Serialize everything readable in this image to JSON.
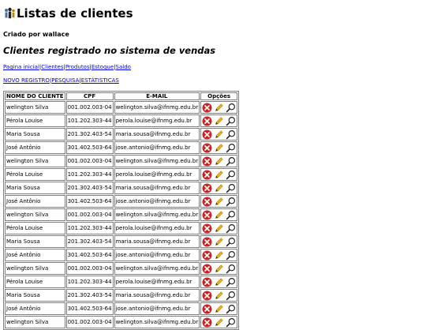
{
  "header": {
    "title": "Listas de clientes",
    "created_by": "Criado por wallace",
    "subtitle": "Clientes registrado no sistema de vendas"
  },
  "nav": {
    "links": [
      "Pagina inicial",
      "Clientes",
      "Produtos",
      "Estoque",
      "Saldo"
    ]
  },
  "actions": {
    "links": [
      "NOVO REGISTRO",
      "PESQUISA",
      "ESTÁTISTICAS"
    ]
  },
  "table": {
    "headers": {
      "name": "NOME DO CLIENTE",
      "cpf": "CPF",
      "email": "E-MAIL",
      "options": "Opções"
    },
    "icons": {
      "delete": "delete-icon",
      "edit": "edit-icon",
      "view": "search-icon"
    },
    "rows": [
      {
        "name": "welington Silva",
        "cpf": "001.002.003-04",
        "email": "welington.silva@ifnmg.edu.br"
      },
      {
        "name": "Pérola Louise",
        "cpf": "101.202.303-44",
        "email": "perola.louise@ifnmg.edu.br"
      },
      {
        "name": "Maria Sousa",
        "cpf": "201.302.403-54",
        "email": "maria.sousa@ifnmg.edu.br"
      },
      {
        "name": "José Antônio",
        "cpf": "301.402.503-64",
        "email": "jose.antonio@ifnmg.edu.br"
      },
      {
        "name": "welington Silva",
        "cpf": "001.002.003-04",
        "email": "welington.silva@ifnmg.edu.br"
      },
      {
        "name": "Pérola Louise",
        "cpf": "101.202.303-44",
        "email": "perola.louise@ifnmg.edu.br"
      },
      {
        "name": "Maria Sousa",
        "cpf": "201.302.403-54",
        "email": "maria.sousa@ifnmg.edu.br"
      },
      {
        "name": "José Antônio",
        "cpf": "301.402.503-64",
        "email": "jose.antonio@ifnmg.edu.br"
      },
      {
        "name": "welington Silva",
        "cpf": "001.002.003-04",
        "email": "welington.silva@ifnmg.edu.br"
      },
      {
        "name": "Pérola Louise",
        "cpf": "101.202.303-44",
        "email": "perola.louise@ifnmg.edu.br"
      },
      {
        "name": "Maria Sousa",
        "cpf": "201.302.403-54",
        "email": "maria.sousa@ifnmg.edu.br"
      },
      {
        "name": "José Antônio",
        "cpf": "301.402.503-64",
        "email": "jose.antonio@ifnmg.edu.br"
      },
      {
        "name": "welington Silva",
        "cpf": "001.002.003-04",
        "email": "welington.silva@ifnmg.edu.br"
      },
      {
        "name": "Pérola Louise",
        "cpf": "101.202.303-44",
        "email": "perola.louise@ifnmg.edu.br"
      },
      {
        "name": "Maria Sousa",
        "cpf": "201.302.403-54",
        "email": "maria.sousa@ifnmg.edu.br"
      },
      {
        "name": "José Antônio",
        "cpf": "301.402.503-64",
        "email": "jose.antonio@ifnmg.edu.br"
      },
      {
        "name": "welington Silva",
        "cpf": "001.002.003-04",
        "email": "welington.silva@ifnmg.edu.br"
      }
    ]
  },
  "colors": {
    "link": "#0000ee",
    "delete": "#cc2222",
    "edit": "#f2b01e"
  }
}
